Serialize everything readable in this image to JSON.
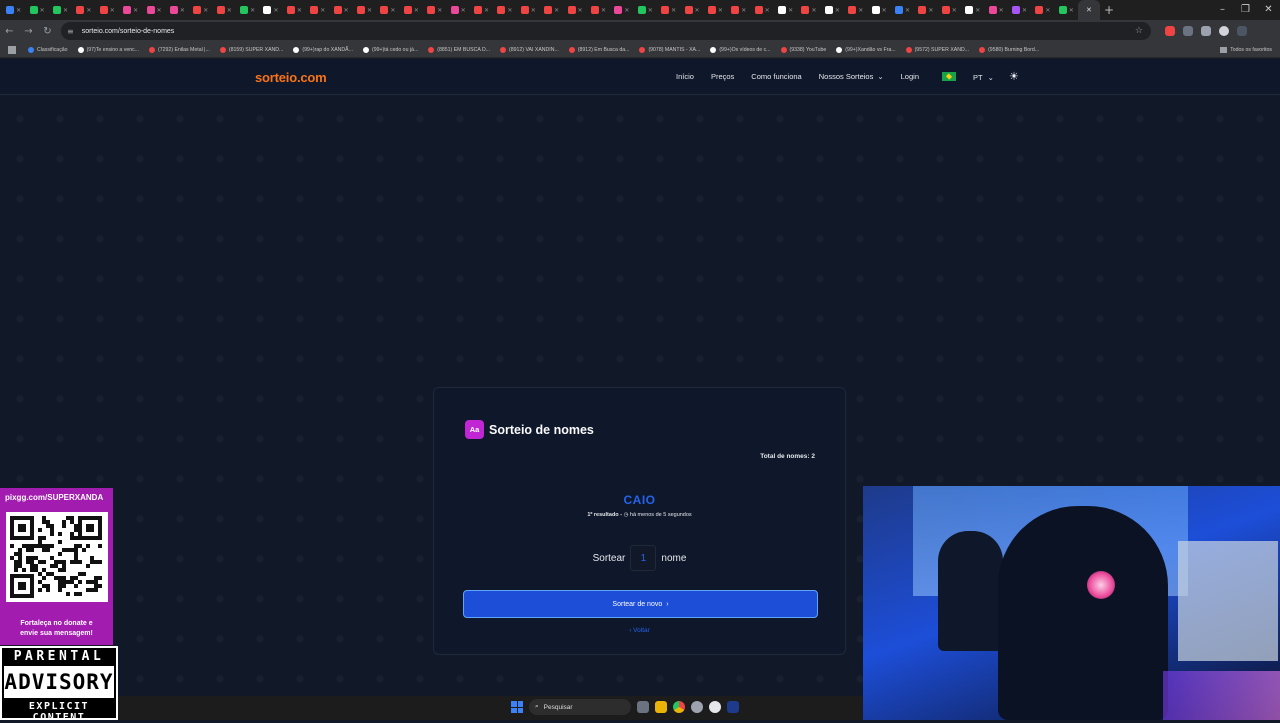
{
  "browser": {
    "url": "sorteio.com/sorteio-de-nomes",
    "tab_count": 46,
    "bookmarks": [
      {
        "label": "Classificação",
        "color": "#3b82f6"
      },
      {
        "label": "(97)Te ensino a venc...",
        "color": "#ffffff"
      },
      {
        "label": "(7292) Enilas Metal |...",
        "color": "#ef4444"
      },
      {
        "label": "(8159) SUPER XAND...",
        "color": "#ef4444"
      },
      {
        "label": "(99+)rap do XANDÃ...",
        "color": "#ffffff"
      },
      {
        "label": "(99+)tá cedo ou já...",
        "color": "#ffffff"
      },
      {
        "label": "(8851) EM BUSCA D...",
        "color": "#ef4444"
      },
      {
        "label": "(8912) VAI XANDIN...",
        "color": "#ef4444"
      },
      {
        "label": "(8912) Em Busca da...",
        "color": "#ef4444"
      },
      {
        "label": "(9078) MANTIS - XA...",
        "color": "#ef4444"
      },
      {
        "label": "(99+)Os vídeos de c...",
        "color": "#ffffff"
      },
      {
        "label": "(9338) YouTube",
        "color": "#ef4444"
      },
      {
        "label": "(99+)Xandão vs Fra...",
        "color": "#ffffff"
      },
      {
        "label": "(9572) SUPER XAND...",
        "color": "#ef4444"
      },
      {
        "label": "(9580) Burning Bord...",
        "color": "#ef4444"
      }
    ],
    "all_favorites_label": "Todos os favoritos"
  },
  "site": {
    "logo": "sorteio.com",
    "nav": {
      "inicio": "Início",
      "precos": "Preços",
      "como_funciona": "Como funciona",
      "nossos_sorteios": "Nossos Sorteios",
      "login": "Login",
      "language": "PT"
    }
  },
  "card": {
    "badge": "Aa",
    "title": "Sorteio de nomes",
    "total_label": "Total de nomes: 2",
    "winner": "CAIO",
    "result_position": "1º resultado -",
    "result_time": "há menos de 5 segundos",
    "draw_prefix": "Sortear",
    "draw_quantity": "1",
    "draw_suffix": "nome",
    "redraw_button": "Sortear de novo",
    "back_link": "Voltar"
  },
  "overlay": {
    "pix_url": "pixgg.com/SUPERXANDA",
    "message_line1": "Fortaleça no donate e",
    "message_line2": "envie sua mensagem!",
    "advisory_top": "PARENTAL",
    "advisory_mid": "ADVISORY",
    "advisory_bottom": "EXPLICIT CONTENT"
  },
  "taskbar": {
    "search_placeholder": "Pesquisar"
  },
  "colors": {
    "accent": "#1d4ed8",
    "logo": "#f97316",
    "badge": "#c026d3",
    "overlay": "#a21caf"
  }
}
